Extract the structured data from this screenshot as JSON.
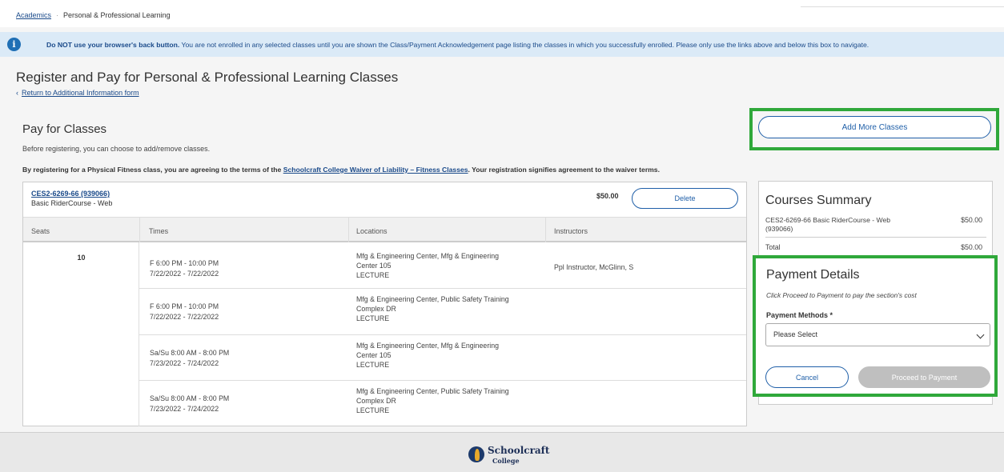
{
  "breadcrumb": {
    "home": "Academics",
    "separator": "·",
    "current": "Personal & Professional Learning"
  },
  "notice": {
    "icon": "info-icon",
    "bold": "Do NOT use your browser's back button.",
    "text": " You are not enrolled in any selected classes until you are shown the Class/Payment Acknowledgement page listing the classes in which you successfully enrolled. Please only use the links above and below this box to navigate."
  },
  "page": {
    "title": "Register and Pay for Personal & Professional Learning Classes",
    "back_link": "Return to Additional Information form"
  },
  "pay_section": {
    "title": "Pay for Classes",
    "subtitle": "Before registering, you can choose to add/remove classes.",
    "waiver_prefix": "By registering for a Physical Fitness class, you are agreeing to the terms of the ",
    "waiver_link": "Schoolcraft College Waiver of Liability – Fitness Classes",
    "waiver_suffix": ". Your registration signifies agreement to the waiver terms."
  },
  "course": {
    "code": "CES2-6269-66 (939066)",
    "name": "Basic RiderCourse - Web",
    "price": "$50.00",
    "delete_label": "Delete",
    "columns": [
      "Seats",
      "Times",
      "Locations",
      "Instructors"
    ],
    "seats": "10",
    "meetings": [
      {
        "time_days": "F 6:00 PM - 10:00 PM",
        "time_dates": "7/22/2022 - 7/22/2022",
        "loc_1": "Mfg & Engineering Center, Mfg & Engineering",
        "loc_2": "Center 105",
        "loc_3": "LECTURE",
        "instructor": "Ppl Instructor, McGlinn, S"
      },
      {
        "time_days": "F 6:00 PM - 10:00 PM",
        "time_dates": "7/22/2022 - 7/22/2022",
        "loc_1": "Mfg & Engineering Center, Public Safety Training",
        "loc_2": "Complex DR",
        "loc_3": "LECTURE",
        "instructor": ""
      },
      {
        "time_days": "Sa/Su 8:00 AM - 8:00 PM",
        "time_dates": "7/23/2022 - 7/24/2022",
        "loc_1": "Mfg & Engineering Center, Mfg & Engineering",
        "loc_2": "Center 105",
        "loc_3": "LECTURE",
        "instructor": ""
      },
      {
        "time_days": "Sa/Su 8:00 AM - 8:00 PM",
        "time_dates": "7/23/2022 - 7/24/2022",
        "loc_1": "Mfg & Engineering Center, Public Safety Training",
        "loc_2": "Complex DR",
        "loc_3": "LECTURE",
        "instructor": ""
      }
    ]
  },
  "add_more_label": "Add More Classes",
  "summary": {
    "title": "Courses Summary",
    "item_label": "CES2-6269-66 Basic RiderCourse - Web (939066)",
    "item_price": "$50.00",
    "total_label": "Total",
    "total_value": "$50.00"
  },
  "payment": {
    "title": "Payment Details",
    "note": "Click Proceed to Payment to pay the section's cost",
    "methods_label": "Payment Methods *",
    "select_value": "Please Select",
    "cancel_label": "Cancel",
    "proceed_label": "Proceed to Payment"
  },
  "footer": {
    "logo_name": "Schoolcraft",
    "logo_sub": "College"
  },
  "colors": {
    "link": "#1a4a8a",
    "accent": "#1f5fa8",
    "highlight": "#2fa83a",
    "notice_bg": "#dbeaf7"
  }
}
